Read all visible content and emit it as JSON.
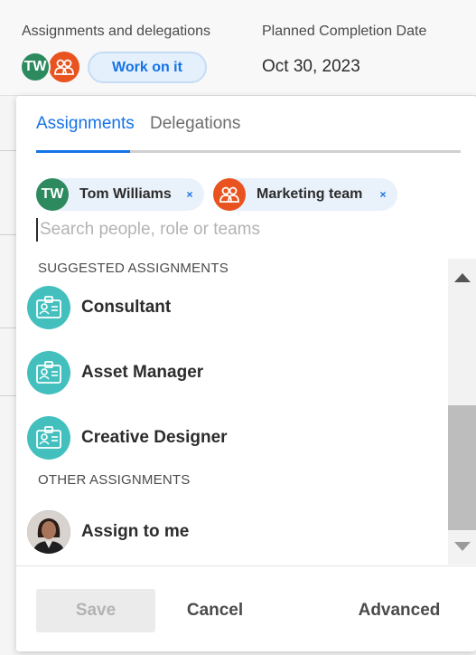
{
  "header": {
    "assignments_label": "Assignments and delegations",
    "date_label": "Planned Completion Date",
    "date_value": "Oct 30, 2023",
    "work_button": "Work on it",
    "avatar_initials": "TW"
  },
  "tabs": [
    {
      "label": "Assignments",
      "active": true
    },
    {
      "label": "Delegations",
      "active": false
    }
  ],
  "chips": [
    {
      "label": "Tom Williams",
      "avatar": "TW",
      "type": "user",
      "color": "#2d8a5f"
    },
    {
      "label": "Marketing team",
      "avatar": "team-icon",
      "type": "team",
      "color": "#e8531f"
    }
  ],
  "remove_glyph": "×",
  "search": {
    "placeholder": "Search people, role or teams",
    "value": ""
  },
  "sections": {
    "suggested": "SUGGESTED ASSIGNMENTS",
    "other": "OTHER ASSIGNMENTS"
  },
  "suggested": [
    {
      "label": "Consultant",
      "icon": "job-role-icon"
    },
    {
      "label": "Asset Manager",
      "icon": "job-role-icon"
    },
    {
      "label": "Creative Designer",
      "icon": "job-role-icon"
    }
  ],
  "other": [
    {
      "label": "Assign to me",
      "icon": "user-photo"
    }
  ],
  "footer": {
    "save": "Save",
    "cancel": "Cancel",
    "advanced": "Advanced"
  },
  "colors": {
    "accent": "#1473e6",
    "role_icon": "#43c0be",
    "tw_avatar": "#2d8a5f",
    "team_avatar": "#e8531f"
  }
}
